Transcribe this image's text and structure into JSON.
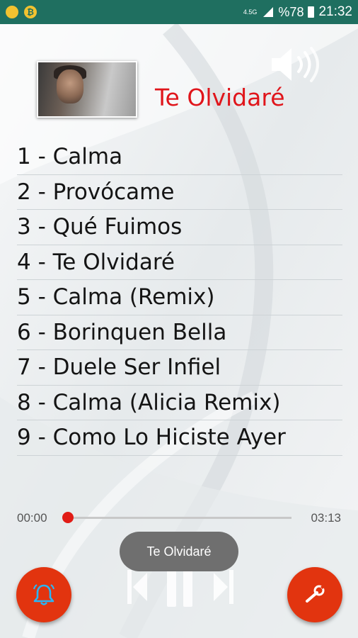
{
  "status_bar": {
    "notification_icons": [
      "circle-notification-icon",
      "bitcoin-icon"
    ],
    "bitcoin_symbol": "₿",
    "network": "4.5G",
    "battery": "%78",
    "time": "21:32"
  },
  "now_playing": {
    "title": "Te Olvidaré"
  },
  "tracks": [
    {
      "label": "1 - Calma"
    },
    {
      "label": "2 - Provócame"
    },
    {
      "label": "3 - Qué Fuimos"
    },
    {
      "label": "4 - Te Olvidaré"
    },
    {
      "label": "5 - Calma (Remix)"
    },
    {
      "label": "6 - Borinquen Bella"
    },
    {
      "label": "7 - Duele Ser Infiel"
    },
    {
      "label": "8 - Calma (Alicia Remix)"
    },
    {
      "label": "9 - Como Lo Hiciste Ayer"
    }
  ],
  "player": {
    "current_time": "00:00",
    "duration": "03:13",
    "progress": 0.0
  },
  "toast": "Te Olvidaré",
  "colors": {
    "status_bar": "#1f6f60",
    "accent_red": "#e0151b",
    "fab": "#e2340f"
  }
}
